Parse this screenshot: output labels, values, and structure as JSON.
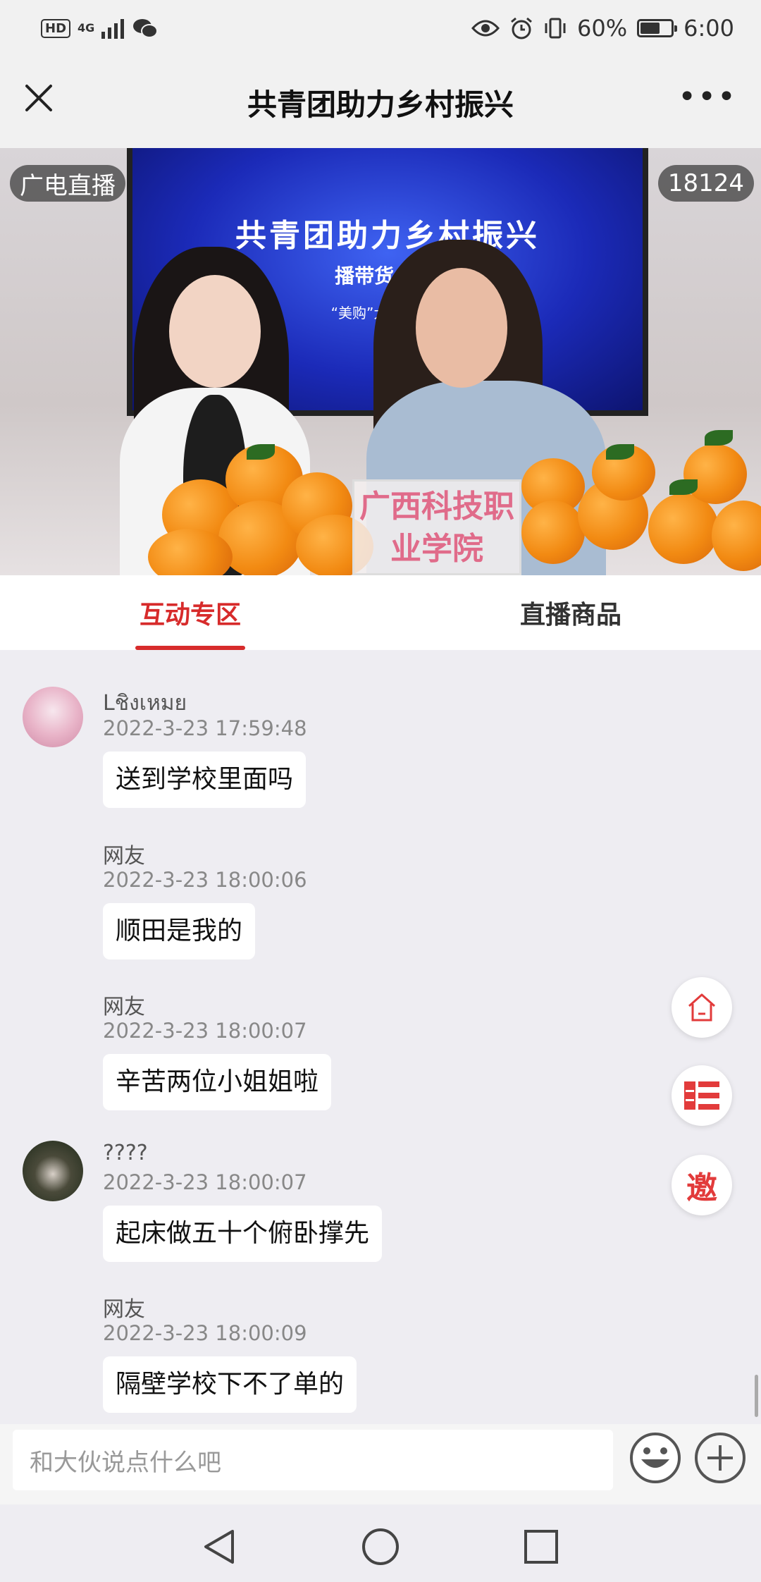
{
  "status_bar": {
    "hd": "HD",
    "network": "4G",
    "battery_text": "60%",
    "battery_level": 0.6,
    "time": "6:00"
  },
  "title_bar": {
    "title": "共青团助力乡村振兴"
  },
  "video": {
    "source_label": "广电直播",
    "viewer_count": "18124",
    "screen_title": "共青团助力乡村振兴",
    "screen_subtitle": "播带货  助农",
    "screen_subtitle2": "“美购”大型电商直",
    "sign_text": "广西科技职业学院"
  },
  "tabs": [
    {
      "label": "互动专区",
      "active": true
    },
    {
      "label": "直播商品",
      "active": false
    }
  ],
  "messages": [
    {
      "name": "Lชิงเหมย",
      "time": "2022-3-23 17:59:48",
      "text": "送到学校里面吗",
      "avatar": "av1"
    },
    {
      "name": "网友",
      "time": "2022-3-23 18:00:06",
      "text": "顺田是我的",
      "avatar": ""
    },
    {
      "name": "网友",
      "time": "2022-3-23 18:00:07",
      "text": "辛苦两位小姐姐啦",
      "avatar": ""
    },
    {
      "name": "????",
      "time": "2022-3-23 18:00:07",
      "text": "起床做五十个俯卧撑先",
      "avatar": "av2"
    },
    {
      "name": "网友",
      "time": "2022-3-23 18:00:09",
      "text": "隔壁学校下不了单的",
      "avatar": ""
    }
  ],
  "floating": {
    "invite_label": "邀"
  },
  "input": {
    "placeholder": "和大伙说点什么吧"
  },
  "colors": {
    "accent": "#d72b2b",
    "icon_red": "#e23b3b"
  }
}
